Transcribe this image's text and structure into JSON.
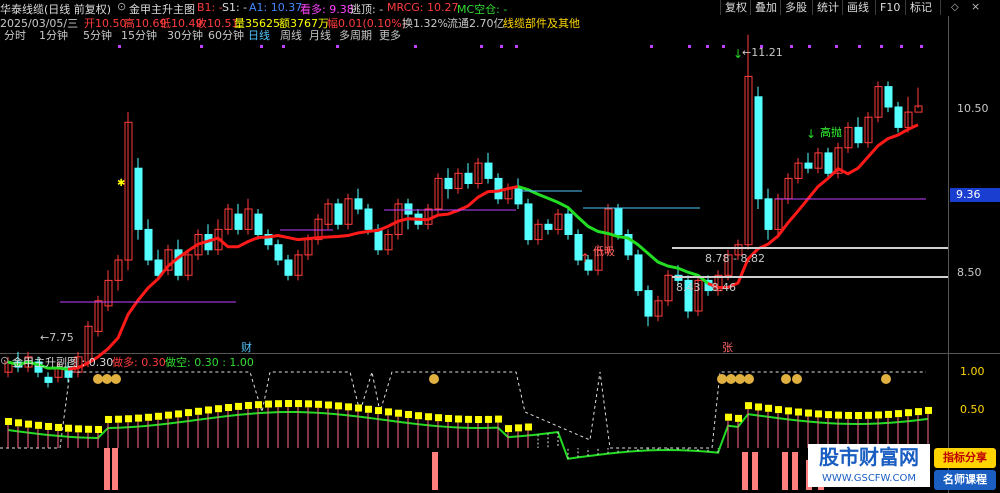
{
  "row1": {
    "title": "华泰线缆(日线 前复权)",
    "indicator_name": "金甲主升主图",
    "b1": "B1: -",
    "s1": "S1: -",
    "a1": "A1: 10.37",
    "kd": "看多: 9.38",
    "ts": "逃顶: -",
    "mrcg": "MRCG: 10.27",
    "mc": "MC空仓: -"
  },
  "row2": {
    "date": "2025/03/05/三",
    "open": "开10.50",
    "high": "高10.69",
    "low": "低10.49",
    "close": "收10.51",
    "volume": "量35625",
    "amount": "额3767万",
    "change": "幅0.01(0.10%)",
    "turnover": "换1.32%",
    "float": "流通2.70亿",
    "sector": "线缆部件及其他"
  },
  "periods": [
    "分时",
    "1分钟",
    "5分钟",
    "15分钟",
    "30分钟",
    "60分钟",
    "日线",
    "周线",
    "月线",
    "多周期",
    "更多"
  ],
  "active_period": "日线",
  "toolbar": [
    "复权",
    "叠加",
    "多股",
    "统计",
    "画线",
    "F10",
    "标记"
  ],
  "price_axis": [
    "10.50",
    "9.36",
    "8.50"
  ],
  "sub_axis": [
    "1.00",
    "0.50"
  ],
  "annotations": {
    "low_price": "7.75",
    "high_price": "11.21",
    "zone1": "8.78 - 8.82",
    "zone2": "8.43 - 8.46",
    "low_signal": "低吸",
    "high_signal": "高抛",
    "tag_finance": "财",
    "tag_rise": "张",
    "bottom_label": "平"
  },
  "sub_header": {
    "name": "金甲主升副图 : 0.30",
    "long": "做多: 0.30",
    "short": "做空: 0.30 : 1.00"
  },
  "watermark": {
    "title": "股市财富网",
    "url": "WWW.GSCFW.COM",
    "tag1": "指标分享",
    "tag2": "名师课程"
  },
  "colors": {
    "up": "#ff3c3c",
    "down": "#54ffff",
    "ma": "#ff1a1a",
    "green_line": "#22dd22",
    "purple": "#c040ff",
    "yellow": "#ffff00"
  }
}
